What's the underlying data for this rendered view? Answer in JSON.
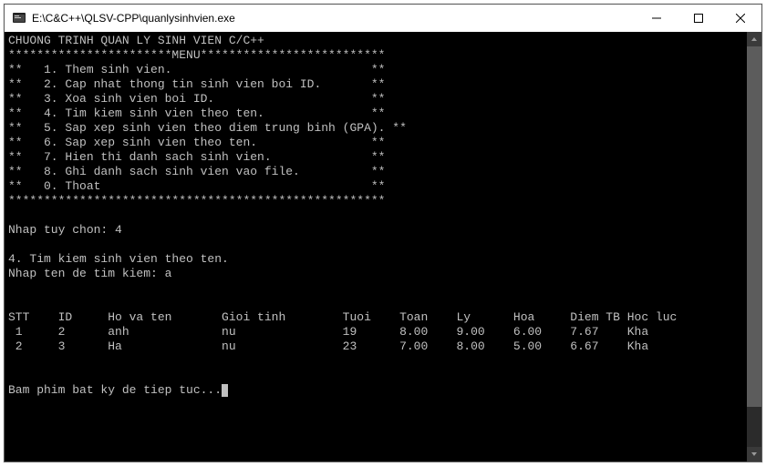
{
  "window": {
    "title": "E:\\C&C++\\QLSV-CPP\\quanlysinhvien.exe"
  },
  "headerLine": "CHUONG TRINH QUAN LY SINH VIEN C/C++",
  "menuBannerTop": "***********************MENU**************************",
  "menuItems": [
    "**   1. Them sinh vien.                            **",
    "**   2. Cap nhat thong tin sinh vien boi ID.       **",
    "**   3. Xoa sinh vien boi ID.                      **",
    "**   4. Tim kiem sinh vien theo ten.               **",
    "**   5. Sap xep sinh vien theo diem trung binh (GPA). **",
    "**   6. Sap xep sinh vien theo ten.                **",
    "**   7. Hien thi danh sach sinh vien.              **",
    "**   8. Ghi danh sach sinh vien vao file.          **",
    "**   0. Thoat                                      **"
  ],
  "menuBannerBottom": "*****************************************************",
  "promptChoiceLabel": "Nhap tuy chon: ",
  "promptChoiceValue": "4",
  "selectedLabel": "4. Tim kiem sinh vien theo ten.",
  "searchPromptLabel": "Nhap ten de tim kiem: ",
  "searchPromptValue": "a",
  "table": {
    "headers": [
      "STT",
      "ID",
      "Ho va ten",
      "Gioi tinh",
      "Tuoi",
      "Toan",
      "Ly",
      "Hoa",
      "Diem TB",
      "Hoc luc"
    ],
    "rows": [
      {
        "stt": " 1",
        "id": "2",
        "name": "anh",
        "sex": "nu",
        "age": "19",
        "toan": "8.00",
        "ly": "9.00",
        "hoa": "6.00",
        "gpa": "7.67",
        "rank": "Kha"
      },
      {
        "stt": " 2",
        "id": "3",
        "name": "Ha",
        "sex": "nu",
        "age": "23",
        "toan": "7.00",
        "ly": "8.00",
        "hoa": "5.00",
        "gpa": "6.67",
        "rank": "Kha"
      }
    ]
  },
  "continuePrompt": "Bam phim bat ky de tiep tuc..."
}
